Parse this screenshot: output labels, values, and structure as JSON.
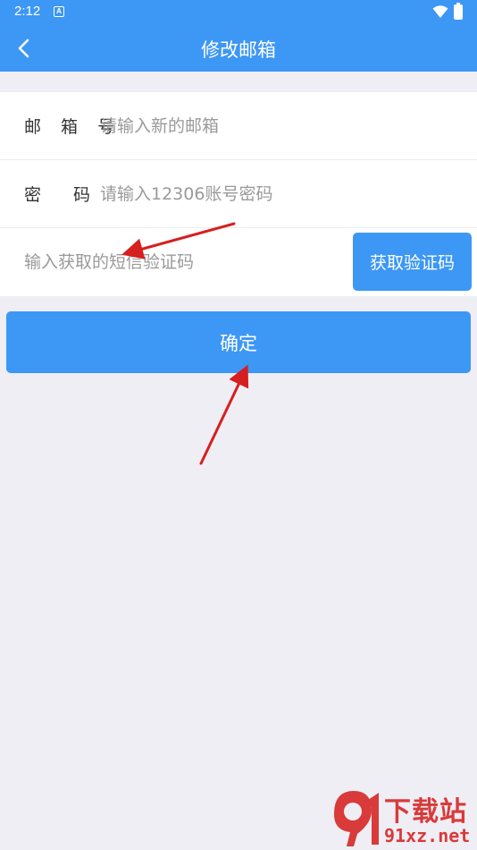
{
  "status_bar": {
    "time": "2:12",
    "notification_badge": "A"
  },
  "header": {
    "title": "修改邮箱"
  },
  "form": {
    "email": {
      "label": "邮 箱 号",
      "placeholder": "请输入新的邮箱",
      "value": ""
    },
    "password": {
      "label_left": "密",
      "label_right": "码",
      "placeholder": "请输入12306账号密码",
      "value": ""
    },
    "code": {
      "placeholder": "输入获取的短信验证码",
      "value": "",
      "button_label": "获取验证码"
    }
  },
  "confirm_label": "确定",
  "watermark": {
    "title": "下载站",
    "url": "91xz.net"
  },
  "colors": {
    "primary": "#3d97f5",
    "background": "#efeef4",
    "annotation_arrow": "#d61f1f"
  }
}
